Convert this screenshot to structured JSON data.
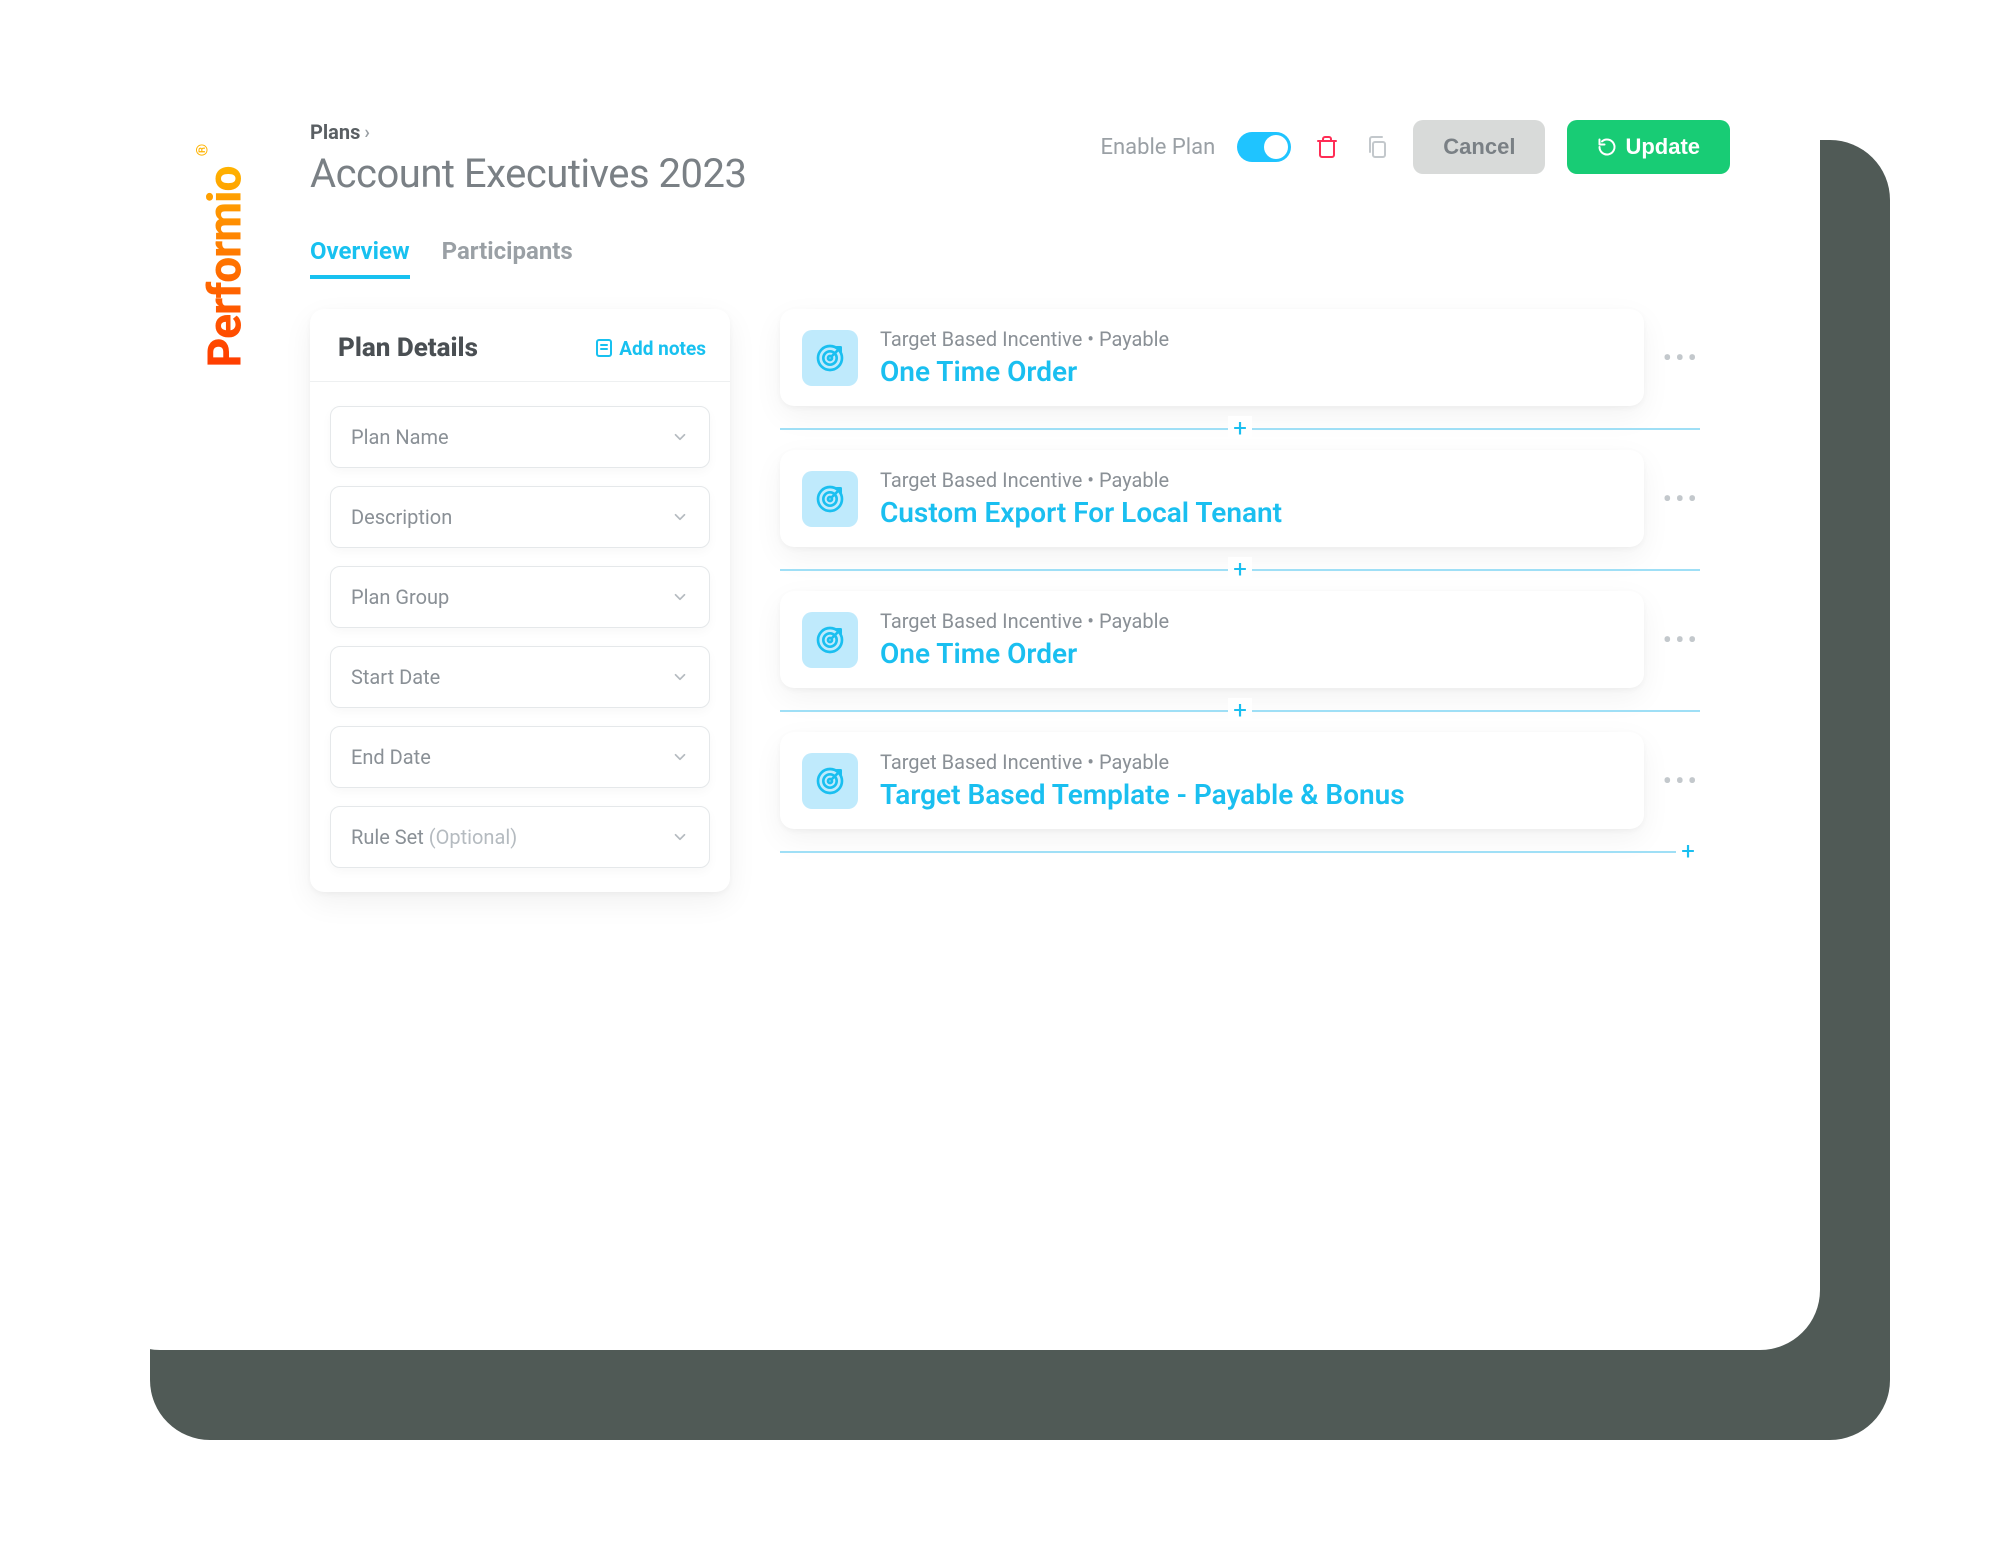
{
  "brand": "Performio",
  "breadcrumb": {
    "root": "Plans"
  },
  "header": {
    "title": "Account Executives 2023",
    "enable_label": "Enable Plan",
    "enabled": true,
    "cancel_label": "Cancel",
    "update_label": "Update"
  },
  "tabs": [
    {
      "label": "Overview",
      "active": true
    },
    {
      "label": "Participants",
      "active": false
    }
  ],
  "panel": {
    "title": "Plan Details",
    "add_notes_label": "Add notes",
    "fields": [
      {
        "label": "Plan Name",
        "optional": ""
      },
      {
        "label": "Description",
        "optional": ""
      },
      {
        "label": "Plan Group",
        "optional": ""
      },
      {
        "label": "Start Date",
        "optional": ""
      },
      {
        "label": "End Date",
        "optional": ""
      },
      {
        "label": "Rule Set",
        "optional": "(Optional)"
      }
    ]
  },
  "incentives": [
    {
      "meta": "Target Based Incentive • Payable",
      "title": "One Time Order"
    },
    {
      "meta": "Target Based Incentive • Payable",
      "title": "Custom Export For Local Tenant"
    },
    {
      "meta": "Target Based Incentive • Payable",
      "title": "One Time Order"
    },
    {
      "meta": "Target Based Incentive • Payable",
      "title": "Target Based Template - Payable & Bonus"
    }
  ],
  "colors": {
    "accent": "#18c1f0",
    "success": "#18cc75",
    "danger": "#ff2d55",
    "muted": "#9aa0a5"
  }
}
